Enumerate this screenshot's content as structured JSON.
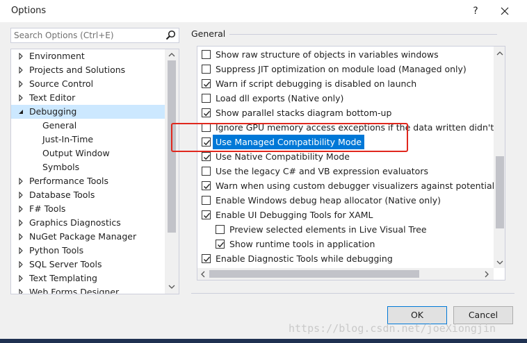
{
  "window": {
    "title": "Options",
    "help_label": "?",
    "close_icon": "close-icon"
  },
  "search": {
    "placeholder": "Search Options (Ctrl+E)",
    "icon": "search-icon"
  },
  "tree": {
    "items": [
      {
        "label": "Environment",
        "level": 1,
        "expanded": false,
        "selected": false
      },
      {
        "label": "Projects and Solutions",
        "level": 1,
        "expanded": false,
        "selected": false
      },
      {
        "label": "Source Control",
        "level": 1,
        "expanded": false,
        "selected": false
      },
      {
        "label": "Text Editor",
        "level": 1,
        "expanded": false,
        "selected": false
      },
      {
        "label": "Debugging",
        "level": 1,
        "expanded": true,
        "selected": true
      },
      {
        "label": "General",
        "level": 2,
        "expanded": false,
        "selected": false
      },
      {
        "label": "Just-In-Time",
        "level": 2,
        "expanded": false,
        "selected": false
      },
      {
        "label": "Output Window",
        "level": 2,
        "expanded": false,
        "selected": false
      },
      {
        "label": "Symbols",
        "level": 2,
        "expanded": false,
        "selected": false
      },
      {
        "label": "Performance Tools",
        "level": 1,
        "expanded": false,
        "selected": false
      },
      {
        "label": "Database Tools",
        "level": 1,
        "expanded": false,
        "selected": false
      },
      {
        "label": "F# Tools",
        "level": 1,
        "expanded": false,
        "selected": false
      },
      {
        "label": "Graphics Diagnostics",
        "level": 1,
        "expanded": false,
        "selected": false
      },
      {
        "label": "NuGet Package Manager",
        "level": 1,
        "expanded": false,
        "selected": false
      },
      {
        "label": "Python Tools",
        "level": 1,
        "expanded": false,
        "selected": false
      },
      {
        "label": "SQL Server Tools",
        "level": 1,
        "expanded": false,
        "selected": false
      },
      {
        "label": "Text Templating",
        "level": 1,
        "expanded": false,
        "selected": false
      },
      {
        "label": "Web Forms Designer",
        "level": 1,
        "expanded": false,
        "selected": false
      }
    ]
  },
  "section": {
    "title": "General"
  },
  "options": [
    {
      "label": "Show raw structure of objects in variables windows",
      "checked": false,
      "indent": 1,
      "highlight": false
    },
    {
      "label": "Suppress JIT optimization on module load (Managed only)",
      "checked": false,
      "indent": 1,
      "highlight": false
    },
    {
      "label": "Warn if script debugging is disabled on launch",
      "checked": true,
      "indent": 1,
      "highlight": false
    },
    {
      "label": "Load dll exports (Native only)",
      "checked": false,
      "indent": 1,
      "highlight": false
    },
    {
      "label": "Show parallel stacks diagram bottom-up",
      "checked": true,
      "indent": 1,
      "highlight": false
    },
    {
      "label": "Ignore GPU memory access exceptions if the data written didn't char",
      "checked": false,
      "indent": 1,
      "highlight": false
    },
    {
      "label": "Use Managed Compatibility Mode",
      "checked": true,
      "indent": 1,
      "highlight": true
    },
    {
      "label": "Use Native Compatibility Mode",
      "checked": true,
      "indent": 1,
      "highlight": false
    },
    {
      "label": "Use the legacy C# and VB expression evaluators",
      "checked": false,
      "indent": 1,
      "highlight": false
    },
    {
      "label": "Warn when using custom debugger visualizers against potentially un",
      "checked": true,
      "indent": 1,
      "highlight": false
    },
    {
      "label": "Enable Windows debug heap allocator (Native only)",
      "checked": false,
      "indent": 1,
      "highlight": false
    },
    {
      "label": "Enable UI Debugging Tools for XAML",
      "checked": true,
      "indent": 1,
      "highlight": false
    },
    {
      "label": "Preview selected elements in Live Visual Tree",
      "checked": false,
      "indent": 2,
      "highlight": false
    },
    {
      "label": "Show runtime tools in application",
      "checked": true,
      "indent": 2,
      "highlight": false
    },
    {
      "label": "Enable Diagnostic Tools while debugging",
      "checked": true,
      "indent": 1,
      "highlight": false
    }
  ],
  "buttons": {
    "ok": "OK",
    "cancel": "Cancel"
  },
  "watermark": "https://blog.csdn.net/joeXiongjin",
  "colors": {
    "selection": "#0078d7",
    "tree_selected": "#cce8ff",
    "annotation": "#e0271d"
  }
}
